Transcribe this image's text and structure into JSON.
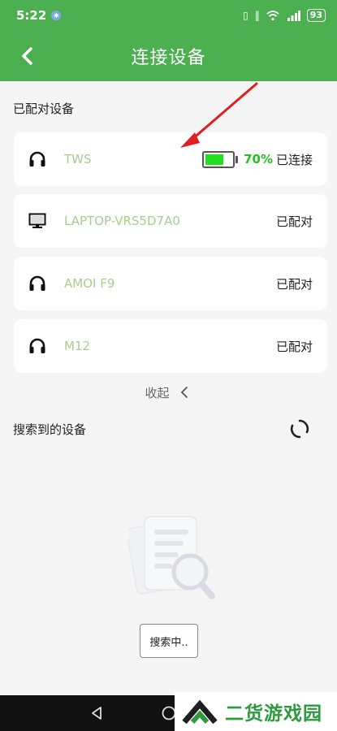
{
  "status": {
    "time": "5:22",
    "battery": "93"
  },
  "header": {
    "title": "连接设备"
  },
  "paired": {
    "label": "已配对设备",
    "devices": [
      {
        "name": "TWS",
        "icon": "headphones-icon",
        "status": "已连接",
        "battery_pct": "70%",
        "battery_level": 0.7
      },
      {
        "name": "LAPTOP-VRS5D7A0",
        "icon": "monitor-icon",
        "status": "已配对"
      },
      {
        "name": "AMOI F9",
        "icon": "headphones-icon",
        "status": "已配对"
      },
      {
        "name": "M12",
        "icon": "headphones-icon",
        "status": "已配对"
      }
    ],
    "collapse_label": "收起"
  },
  "search": {
    "label": "搜索到的设备",
    "button_label": "搜索中.."
  },
  "watermark": {
    "text": "二货游戏园"
  },
  "colors": {
    "primary": "#4caf50",
    "battery_fill": "#20e020",
    "device_name": "#a7cf8c"
  }
}
